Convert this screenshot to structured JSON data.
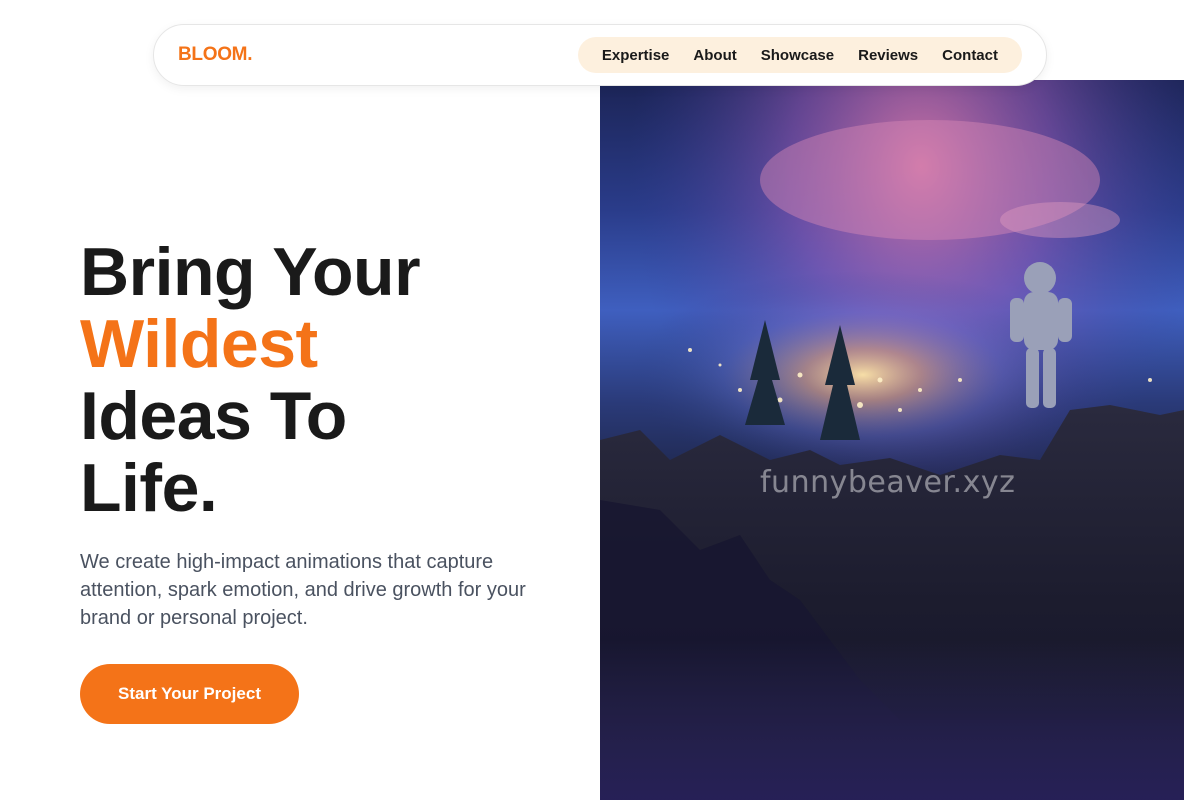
{
  "brand": {
    "logo_text": "BLOOM.",
    "accent_color": "#f47318"
  },
  "nav": {
    "items": [
      {
        "label": "Expertise"
      },
      {
        "label": "About"
      },
      {
        "label": "Showcase"
      },
      {
        "label": "Reviews"
      },
      {
        "label": "Contact"
      }
    ]
  },
  "hero": {
    "headline_line1": "Bring Your",
    "headline_line2": "Wildest",
    "headline_line3": "Ideas To",
    "headline_line4": "Life.",
    "subtext": "We create high-impact animations that capture attention, spark emotion, and drive growth for your brand or personal project.",
    "cta_label": "Start Your Project",
    "image_watermark": "funnybeaver.xyz"
  }
}
